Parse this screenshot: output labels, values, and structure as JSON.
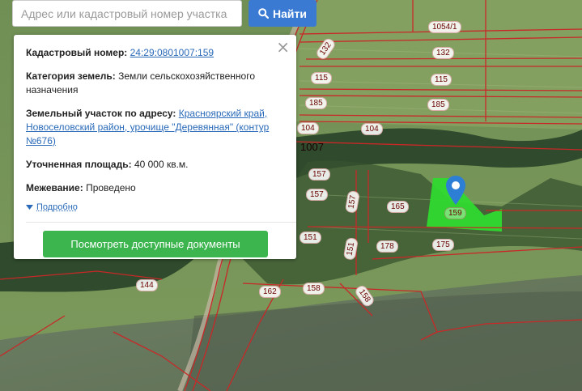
{
  "search": {
    "placeholder": "Адрес или кадастровый номер участка",
    "button_label": "Найти"
  },
  "popup": {
    "cadastral_label": "Кадастровый номер:",
    "cadastral_value": "24:29:0801007:159",
    "category_label": "Категория земель:",
    "category_value": "Земли сельскохозяйственного назначения",
    "address_label": "Земельный участок по адресу:",
    "address_value": "Красноярский край, Новоселовский район, урочище \"Деревянная\" (контур №676)",
    "area_label": "Уточненная площадь:",
    "area_value": "40 000 кв.м.",
    "survey_label": "Межевание:",
    "survey_value": "Проведено",
    "more_label": "Подробно",
    "docs_button": "Посмотреть доступные документы",
    "close_icon": "×"
  },
  "map": {
    "block_label": "1007",
    "selected_parcel": "159",
    "parcel_labels": [
      "1054/1",
      "132",
      "132",
      "115",
      "115",
      "185",
      "185",
      "104",
      "104",
      "157",
      "157",
      "157",
      "165",
      "151",
      "151",
      "178",
      "175",
      "144",
      "162",
      "158",
      "158"
    ]
  },
  "colors": {
    "search_button": "#3a7ad3",
    "docs_button": "#3cb54f",
    "selected_parcel_fill": "#2fdc2f",
    "boundary_lines": "#c82828",
    "marker": "#2d7fd6"
  },
  "icons": {
    "search": "search-icon",
    "close": "close-icon",
    "more": "triangle-down-icon",
    "marker": "map-pin-icon"
  }
}
